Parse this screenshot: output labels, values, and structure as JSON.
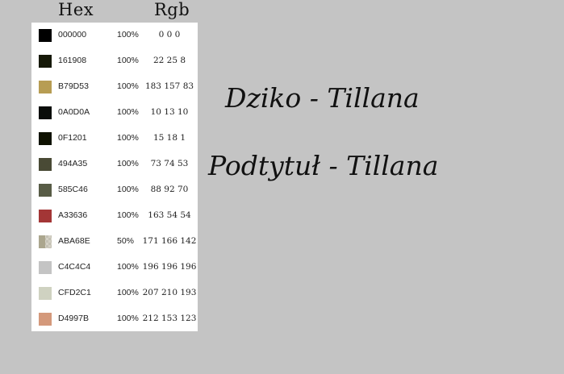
{
  "headers": {
    "hex": "Hex",
    "rgb": "Rgb"
  },
  "palette": [
    {
      "hex": "000000",
      "opacity": "100%",
      "rgb": "0 0 0",
      "color": "#000000"
    },
    {
      "hex": "161908",
      "opacity": "100%",
      "rgb": "22 25 8",
      "color": "#161908"
    },
    {
      "hex": "B79D53",
      "opacity": "100%",
      "rgb": "183 157 83",
      "color": "#B79D53"
    },
    {
      "hex": "0A0D0A",
      "opacity": "100%",
      "rgb": "10 13 10",
      "color": "#0A0D0A"
    },
    {
      "hex": "0F1201",
      "opacity": "100%",
      "rgb": "15 18 1",
      "color": "#0F1201"
    },
    {
      "hex": "494A35",
      "opacity": "100%",
      "rgb": "73 74 53",
      "color": "#494A35"
    },
    {
      "hex": "585C46",
      "opacity": "100%",
      "rgb": "88 92 70",
      "color": "#585C46"
    },
    {
      "hex": "A33636",
      "opacity": "100%",
      "rgb": "163 54 54",
      "color": "#A33636"
    },
    {
      "hex": "ABA68E",
      "opacity": "50%",
      "rgb": "171 166 142",
      "color": "#ABA68E"
    },
    {
      "hex": "C4C4C4",
      "opacity": "100%",
      "rgb": "196 196 196",
      "color": "#C4C4C4"
    },
    {
      "hex": "CFD2C1",
      "opacity": "100%",
      "rgb": "207 210 193",
      "color": "#CFD2C1"
    },
    {
      "hex": "D4997B",
      "opacity": "100%",
      "rgb": "212 153 123",
      "color": "#D4997B"
    }
  ],
  "samples": {
    "title": "Dziko - Tillana",
    "subtitle": "Podtytuł - Tillana"
  },
  "colors": {
    "background": "#C4C4C4",
    "panel": "#FFFFFF"
  }
}
